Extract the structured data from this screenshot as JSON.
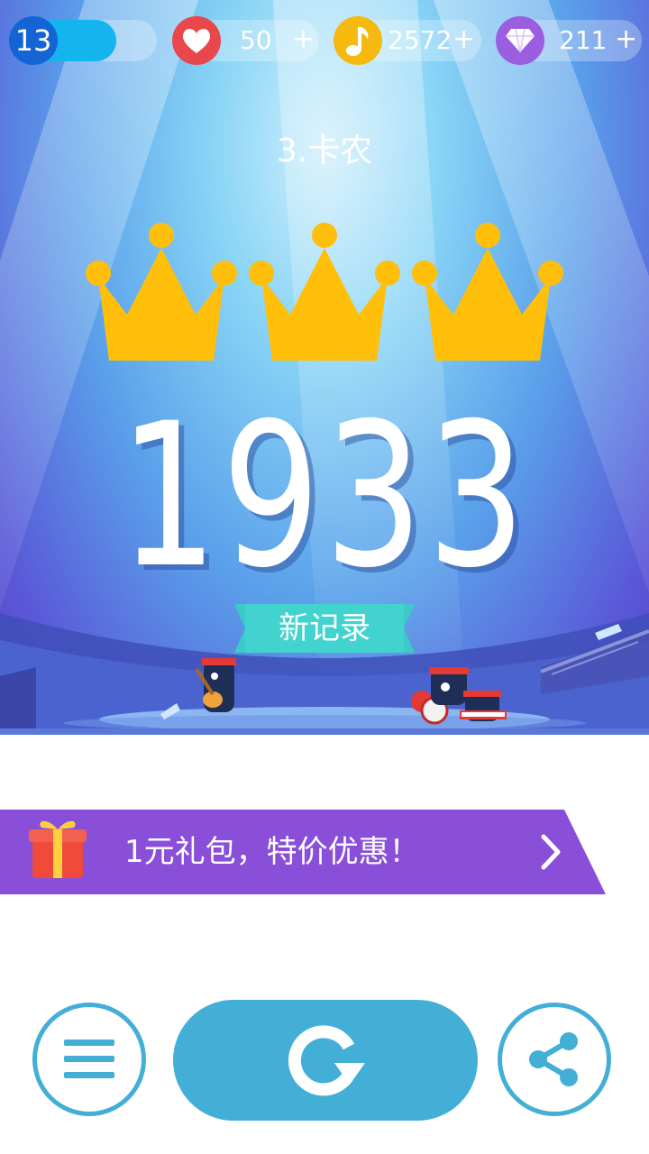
{
  "top_bar": {
    "level": "13",
    "level_progress": 0.72,
    "lives": "50",
    "notes": "2572",
    "diamonds": "211",
    "plus": "+"
  },
  "song": {
    "title": "3.卡农"
  },
  "result": {
    "crowns_earned": 3,
    "crowns_total": 3,
    "score": "1933",
    "new_record_label": "新记录"
  },
  "promo": {
    "label": "1元礼包，特价优惠！"
  },
  "colors": {
    "accent": "#43aed6",
    "crown": "#ffc107",
    "promo": "#8a4fd8",
    "record": "#3cc9c9"
  },
  "icons": {
    "lives": "heart-icon",
    "notes": "music-note-icon",
    "diamonds": "diamond-icon",
    "gift": "gift-icon",
    "arrow": "chevron-right-icon",
    "menu": "menu-icon",
    "replay": "replay-icon",
    "share": "share-icon"
  }
}
